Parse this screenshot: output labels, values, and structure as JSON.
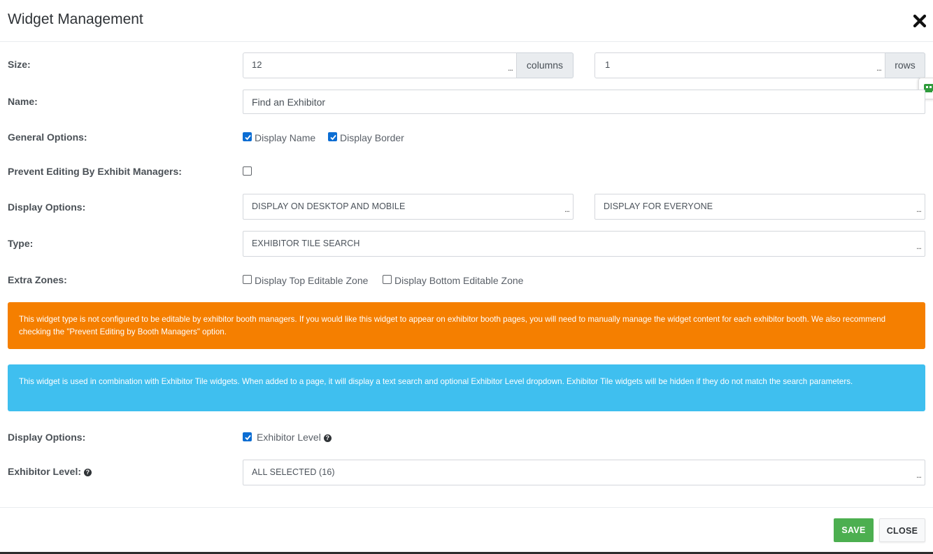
{
  "header": {
    "title": "Widget Management"
  },
  "form": {
    "size": {
      "label": "Size:",
      "columns_value": "12",
      "columns_addon": "columns",
      "rows_value": "1",
      "rows_addon": "rows"
    },
    "name": {
      "label": "Name:",
      "value": "Find an Exhibitor"
    },
    "general_options": {
      "label": "General Options:",
      "display_name": "Display Name",
      "display_border": "Display Border"
    },
    "prevent_editing": {
      "label": "Prevent Editing By Exhibit Managers:"
    },
    "display_options": {
      "label": "Display Options:",
      "device_value": "DISPLAY ON DESKTOP AND MOBILE",
      "audience_value": "DISPLAY FOR EVERYONE"
    },
    "type": {
      "label": "Type:",
      "value": "EXHIBITOR TILE SEARCH"
    },
    "extra_zones": {
      "label": "Extra Zones:",
      "top_zone": "Display Top Editable Zone",
      "bottom_zone": "Display Bottom Editable Zone"
    },
    "alerts": {
      "warning": "This widget type is not configured to be editable by exhibitor booth managers. If you would like this widget to appear on exhibitor booth pages, you will need to manually manage the widget content for each exhibitor booth. We also recommend checking the \"Prevent Editing by Booth Managers\" option.",
      "info": "This widget is used in combination with Exhibitor Tile widgets. When added to a page, it will display a text search and optional Exhibitor Level dropdown. Exhibitor Tile widgets will be hidden if they do not match the search parameters."
    },
    "display_options_2": {
      "label": "Display Options:",
      "exhibitor_level": "Exhibitor Level"
    },
    "exhibitor_level": {
      "label": "Exhibitor Level:",
      "value": "ALL SELECTED (16)"
    },
    "dots": "..."
  },
  "footer": {
    "save_label": "SAVE",
    "close_label": "CLOSE"
  },
  "colors": {
    "warning": "#f57f00",
    "info": "#3fbfef",
    "save": "#4caf50",
    "checkbox": "#0b6dd3"
  },
  "icons": {
    "close": "close-x-icon",
    "help": "question-circle-icon",
    "side_tab": "chat-icon"
  }
}
